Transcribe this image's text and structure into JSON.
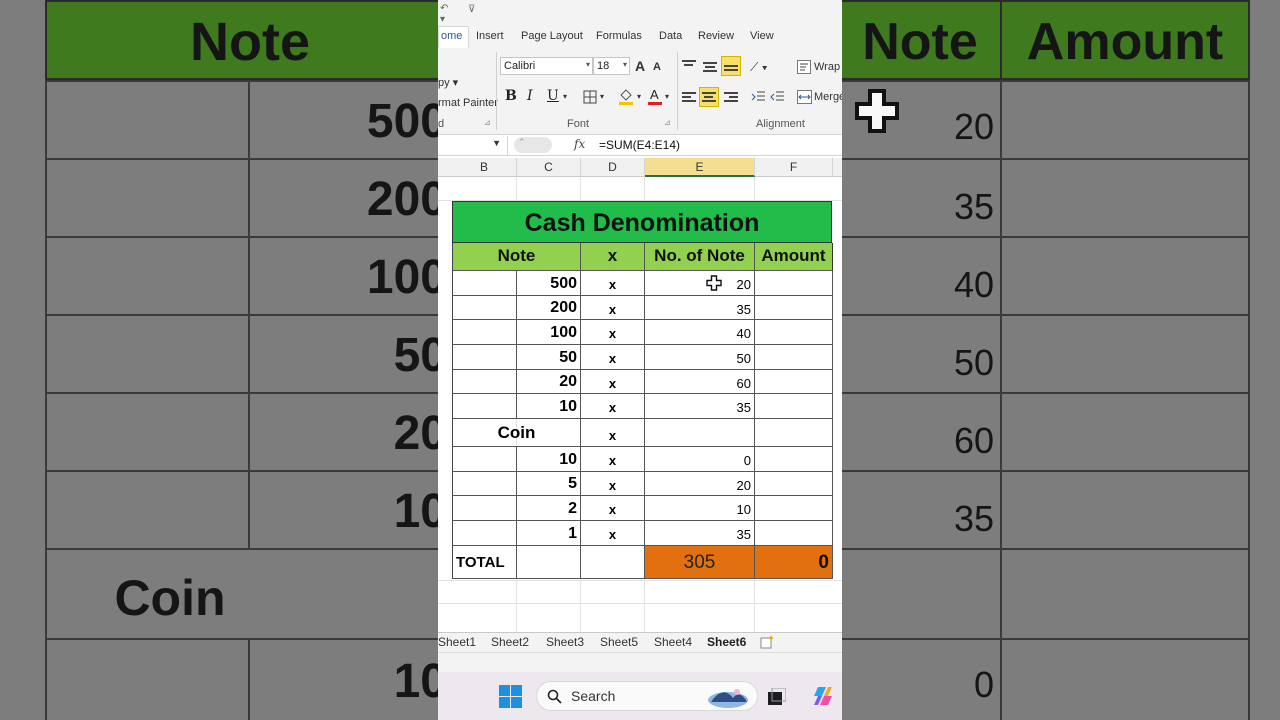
{
  "background": {
    "left": {
      "note_header": "Note",
      "values": [
        "500",
        "200",
        "100",
        "50",
        "20",
        "10"
      ],
      "coin_label": "Coin",
      "coin_first": "10"
    },
    "right": {
      "note_header": "Note",
      "amount_header": "Amount",
      "values": [
        "20",
        "35",
        "40",
        "50",
        "60",
        "35",
        "",
        "0"
      ]
    }
  },
  "ribbon": {
    "tabs": [
      "ome",
      "Insert",
      "Page Layout",
      "Formulas",
      "Data",
      "Review",
      "View"
    ],
    "active_tab": "ome",
    "clipboard_items": [
      "py ▾",
      "rmat Painter"
    ],
    "clipboard_label": "d",
    "font_name": "Calibri",
    "font_size": "18",
    "bold": "B",
    "italic": "I",
    "underline": "U",
    "font_group_label": "Font",
    "alignment_label": "Alignment",
    "wrap_text": "Wrap",
    "merge": "Merge",
    "grow_font": "A",
    "shrink_font": "A"
  },
  "formula_bar": {
    "fx": "fx",
    "formula": "=SUM(E4:E14)"
  },
  "columns": [
    "B",
    "C",
    "D",
    "E",
    "F"
  ],
  "sheet": {
    "title": "Cash Denomination",
    "headers": {
      "note": "Note",
      "x": "x",
      "no_of_note": "No. of Note",
      "amount": "Amount"
    },
    "rows": [
      {
        "note": "500",
        "x": "x",
        "count": "20"
      },
      {
        "note": "200",
        "x": "x",
        "count": "35"
      },
      {
        "note": "100",
        "x": "x",
        "count": "40"
      },
      {
        "note": "50",
        "x": "x",
        "count": "50"
      },
      {
        "note": "20",
        "x": "x",
        "count": "60"
      },
      {
        "note": "10",
        "x": "x",
        "count": "35"
      }
    ],
    "coin_label": "Coin",
    "coin_x": "x",
    "coin_rows": [
      {
        "note": "10",
        "x": "x",
        "count": "0"
      },
      {
        "note": "5",
        "x": "x",
        "count": "20"
      },
      {
        "note": "2",
        "x": "x",
        "count": "10"
      },
      {
        "note": "1",
        "x": "x",
        "count": "35"
      }
    ],
    "total_label": "TOTAL",
    "total_count": "305",
    "total_amount": "0"
  },
  "sheet_tabs": [
    "Sheet1",
    "Sheet2",
    "Sheet3",
    "Sheet5",
    "Sheet4",
    "Sheet6"
  ],
  "active_sheet": "Sheet6",
  "taskbar": {
    "search_label": "Search"
  }
}
